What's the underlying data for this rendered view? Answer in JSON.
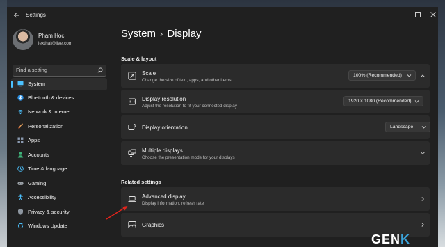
{
  "window": {
    "title": "Settings"
  },
  "user": {
    "name": "Phạm Học",
    "email": "lexthai@live.com"
  },
  "search": {
    "placeholder": "Find a setting"
  },
  "sidebar": {
    "items": [
      {
        "label": "System",
        "icon": "monitor-icon",
        "selected": true
      },
      {
        "label": "Bluetooth & devices",
        "icon": "bluetooth-icon"
      },
      {
        "label": "Network & internet",
        "icon": "network-icon"
      },
      {
        "label": "Personalization",
        "icon": "brush-icon"
      },
      {
        "label": "Apps",
        "icon": "apps-icon"
      },
      {
        "label": "Accounts",
        "icon": "person-icon"
      },
      {
        "label": "Time & language",
        "icon": "globe-clock-icon"
      },
      {
        "label": "Gaming",
        "icon": "gamepad-icon"
      },
      {
        "label": "Accessibility",
        "icon": "accessibility-icon"
      },
      {
        "label": "Privacy & security",
        "icon": "shield-icon"
      },
      {
        "label": "Windows Update",
        "icon": "update-icon"
      }
    ]
  },
  "breadcrumb": {
    "parent": "System",
    "separator": "›",
    "current": "Display"
  },
  "scale_layout": {
    "heading": "Scale & layout",
    "scale": {
      "title": "Scale",
      "subtitle": "Change the size of text, apps, and other items",
      "value": "100% (Recommended)"
    },
    "resolution": {
      "title": "Display resolution",
      "subtitle": "Adjust the resolution to fit your connected display",
      "value": "1920 × 1080 (Recommended)"
    },
    "orientation": {
      "title": "Display orientation",
      "value": "Landscape"
    },
    "multiple": {
      "title": "Multiple displays",
      "subtitle": "Choose the presentation mode for your displays"
    }
  },
  "related": {
    "heading": "Related settings",
    "advanced": {
      "title": "Advanced display",
      "subtitle": "Display information, refresh rate"
    },
    "graphics": {
      "title": "Graphics"
    }
  },
  "watermark": {
    "main": "GEN",
    "accent": "K"
  },
  "colors": {
    "accent": "#4cc2ff",
    "window_bg": "#202020",
    "card_bg": "#2b2b2b",
    "arrow": "#e0241c"
  }
}
